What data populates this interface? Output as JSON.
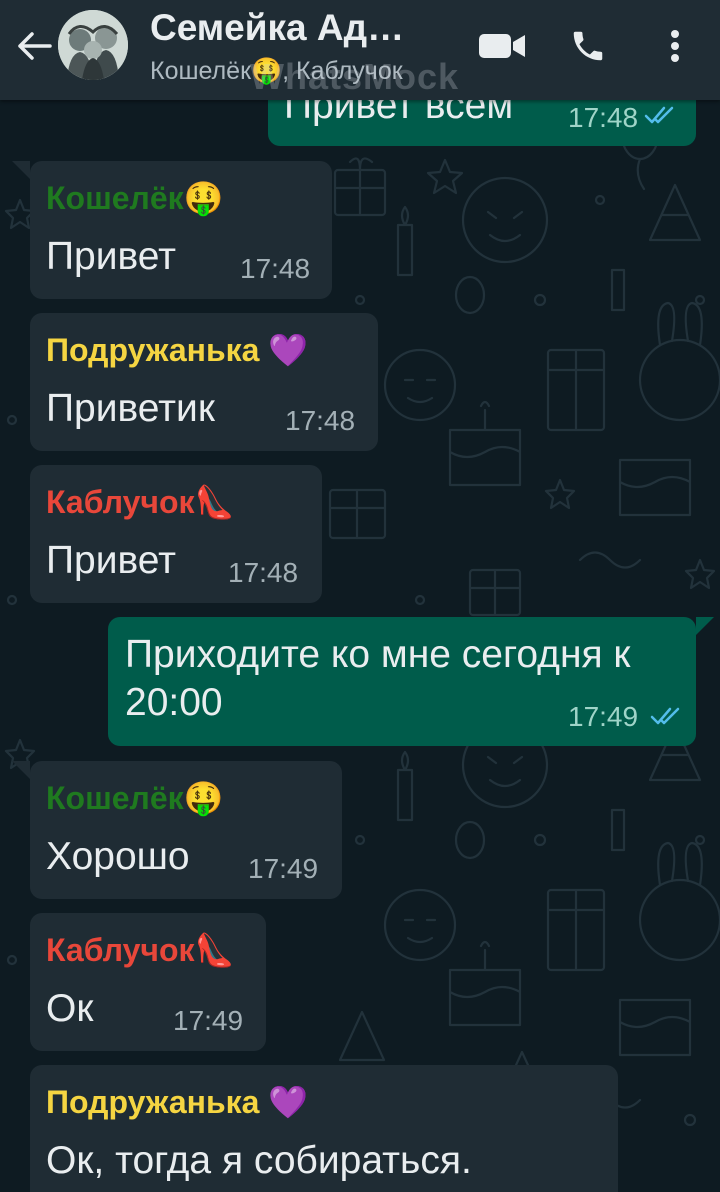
{
  "header": {
    "title": "Семейка Ад…",
    "subtitle": "Кошелёк🤑, Каблучок",
    "watermark": "WhatsMock"
  },
  "icons": {
    "back": "arrow-left-icon",
    "video": "video-call-icon",
    "call": "phone-icon",
    "menu": "more-vertical-icon",
    "read": "double-check-icon"
  },
  "colors": {
    "wallpaper": "#0e1b22",
    "incoming_bubble": "#1f2c34",
    "outgoing_bubble": "#005c4b",
    "sender_koshelek": "#1f7a1f",
    "sender_podruzhanka": "#f5d542",
    "sender_kabluchok": "#e8473a",
    "read_ticks": "#53bdeb"
  },
  "messages": [
    {
      "direction": "out",
      "text": "Привет всем",
      "time": "17:48",
      "status": "read"
    },
    {
      "direction": "in",
      "sender": "Кошелёк",
      "sender_emoji": "🤑",
      "text": "Привет",
      "time": "17:48"
    },
    {
      "direction": "in",
      "sender": "Подружанька",
      "sender_emoji": "💜",
      "text": "Приветик",
      "time": "17:48"
    },
    {
      "direction": "in",
      "sender": "Каблучок",
      "sender_emoji": "👠",
      "text": "Привет",
      "time": "17:48"
    },
    {
      "direction": "out",
      "text_line1": "Приходите ко мне сегодня к",
      "text_line2": "20:00",
      "time": "17:49",
      "status": "read"
    },
    {
      "direction": "in",
      "sender": "Кошелёк",
      "sender_emoji": "🤑",
      "text": "Хорошо",
      "time": "17:49"
    },
    {
      "direction": "in",
      "sender": "Каблучок",
      "sender_emoji": "👠",
      "text": "Ок",
      "time": "17:49"
    },
    {
      "direction": "in",
      "sender": "Подружанька",
      "sender_emoji": "💜",
      "text": "Ок, тогда я собираться."
    }
  ]
}
